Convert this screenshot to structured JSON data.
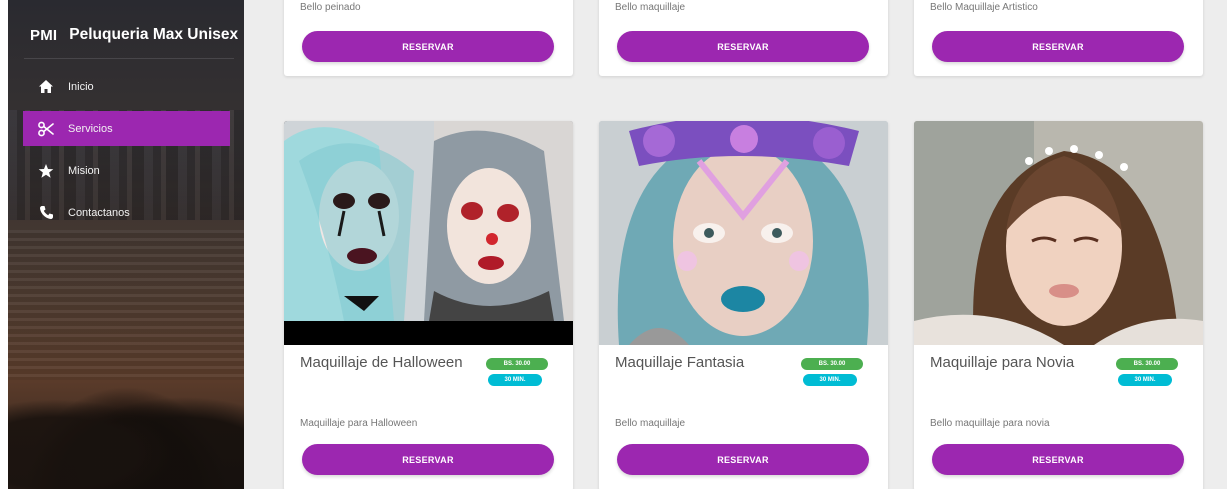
{
  "sidebar": {
    "brand_abbr": "PMI",
    "brand_name": "Peluqueria Max Unisex",
    "items": [
      {
        "label": "Inicio",
        "icon": "home-icon"
      },
      {
        "label": "Servicios",
        "icon": "scissors-icon",
        "active": true
      },
      {
        "label": "Mision",
        "icon": "star-icon"
      },
      {
        "label": "Contactanos",
        "icon": "phone-icon"
      }
    ]
  },
  "top_cards": [
    {
      "desc": "Bello peinado",
      "button": "RESERVAR"
    },
    {
      "desc": "Bello maquillaje",
      "button": "RESERVAR"
    },
    {
      "desc": "Bello Maquillaje Artistico",
      "button": "RESERVAR"
    }
  ],
  "cards": [
    {
      "title": "Maquillaje de Halloween",
      "price": "BS. 30.00",
      "time": "30 MIN.",
      "desc": "Maquillaje para Halloween",
      "button": "RESERVAR"
    },
    {
      "title": "Maquillaje Fantasia",
      "price": "BS. 30.00",
      "time": "30 MIN.",
      "desc": "Bello maquillaje",
      "button": "RESERVAR"
    },
    {
      "title": "Maquillaje para Novia",
      "price": "BS. 30.00",
      "time": "30 MIN.",
      "desc": "Bello maquillaje para novia",
      "button": "RESERVAR"
    }
  ],
  "colors": {
    "accent": "#9c27b0",
    "price_badge": "#4caf50",
    "time_badge": "#00bcd4"
  }
}
